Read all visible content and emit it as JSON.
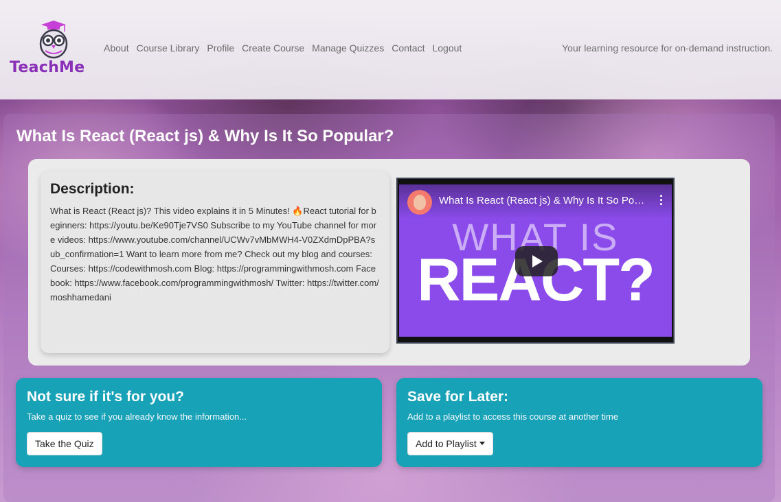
{
  "header": {
    "brand": "TeachMe",
    "nav": [
      "About",
      "Course Library",
      "Profile",
      "Create Course",
      "Manage Quizzes",
      "Contact",
      "Logout"
    ],
    "tagline": "Your learning resource for on-demand instruction."
  },
  "page": {
    "title": "What Is React (React js) & Why Is It So Popular?"
  },
  "description": {
    "heading": "Description:",
    "text": "What is React (React js)? This video explains it in 5 Minutes! 🔥React tutorial for beginners: https://youtu.be/Ke90Tje7VS0 Subscribe to my YouTube channel for more videos: https://www.youtube.com/channel/UCWv7vMbMWH4-V0ZXdmDpPBA?sub_confirmation=1 Want to learn more from me? Check out my blog and courses: Courses: https://codewithmosh.com Blog: https://programmingwithmosh.com Facebook: https://www.facebook.com/programmingwithmosh/ Twitter: https://twitter.com/moshhamedani"
  },
  "video": {
    "title": "What Is React (React js) & Why Is It So Popular?",
    "thumb_line1": "WHAT IS",
    "thumb_line2": "REACT?"
  },
  "quiz_card": {
    "heading": "Not sure if it's for you?",
    "text": "Take a quiz to see if you already know the information...",
    "button": "Take the Quiz"
  },
  "save_card": {
    "heading": "Save for Later:",
    "text": "Add to a playlist to access this course at another time",
    "button": "Add to Playlist"
  }
}
